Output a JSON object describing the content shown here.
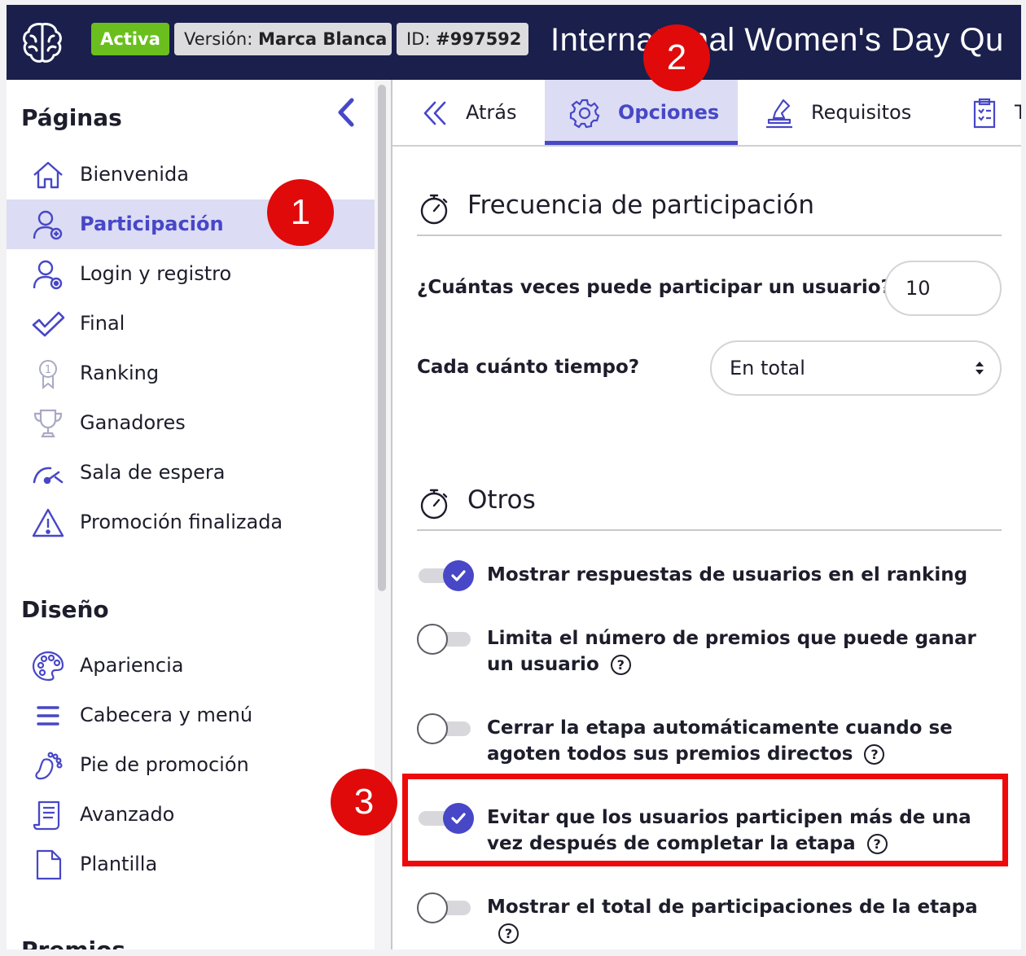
{
  "header": {
    "status_badge": "Activa",
    "version_label": "Versión:",
    "version_value": "Marca Blanca",
    "id_label": "ID:",
    "id_value": "#997592",
    "title": "International Women's Day Qu"
  },
  "sidebar": {
    "pages_heading": "Páginas",
    "pages": [
      {
        "label": "Bienvenida",
        "icon": "home-icon"
      },
      {
        "label": "Participación",
        "icon": "user-plus-icon",
        "active": true
      },
      {
        "label": "Login y registro",
        "icon": "user-at-icon"
      },
      {
        "label": "Final",
        "icon": "check-icon"
      },
      {
        "label": "Ranking",
        "icon": "medal-icon"
      },
      {
        "label": "Ganadores",
        "icon": "trophy-icon"
      },
      {
        "label": "Sala de espera",
        "icon": "gauge-icon"
      },
      {
        "label": "Promoción finalizada",
        "icon": "warning-icon"
      }
    ],
    "design_heading": "Diseño",
    "design": [
      {
        "label": "Apariencia",
        "icon": "palette-icon"
      },
      {
        "label": "Cabecera y menú",
        "icon": "menu-icon"
      },
      {
        "label": "Pie de promoción",
        "icon": "footprint-icon"
      },
      {
        "label": "Avanzado",
        "icon": "scroll-icon"
      },
      {
        "label": "Plantilla",
        "icon": "file-icon"
      }
    ],
    "prizes_heading": "Premios"
  },
  "tabs": [
    {
      "label": "Atrás",
      "icon": "chevrons-left-icon"
    },
    {
      "label": "Opciones",
      "icon": "gear-icon",
      "active": true
    },
    {
      "label": "Requisitos",
      "icon": "stamp-icon"
    },
    {
      "label": "T",
      "icon": "clipboard-icon"
    }
  ],
  "frequency": {
    "title": "Frecuencia de participación",
    "times_label": "¿Cuántas veces puede participar un usuario?",
    "times_value": "10",
    "period_label": "Cada cuánto tiempo?",
    "period_value": "En total"
  },
  "others": {
    "title": "Otros",
    "options": [
      {
        "label": "Mostrar respuestas de usuarios en el ranking",
        "enabled": true,
        "help": false
      },
      {
        "label": "Limita el número de premios que puede ganar un usuario",
        "enabled": false,
        "help": true
      },
      {
        "label": "Cerrar la etapa automáticamente cuando se agoten todos sus premios directos",
        "enabled": false,
        "help": true
      },
      {
        "label": "Evitar que los usuarios participen más de una vez después de completar la etapa",
        "enabled": true,
        "help": true
      },
      {
        "label": "Mostrar el total de participaciones de la etapa",
        "enabled": false,
        "help": true
      }
    ],
    "help_glyph": "?"
  },
  "annotations": {
    "marker_1": "1",
    "marker_2": "2",
    "marker_3": "3",
    "color": "#e00a0a"
  },
  "colors": {
    "header_bg": "#1a1f4c",
    "accent": "#4747c7",
    "active_bg": "#dcdcf4",
    "status_green": "#6abf1e"
  }
}
